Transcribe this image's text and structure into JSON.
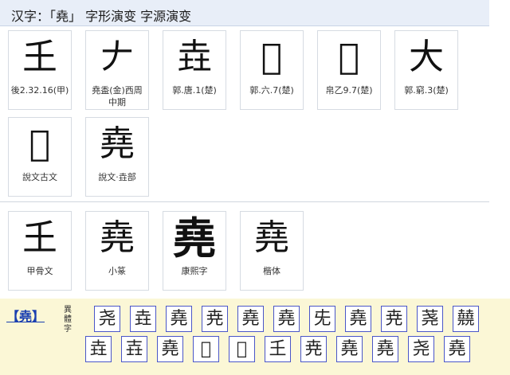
{
  "header": {
    "title": "汉字：「堯」 字形演变 字源演变"
  },
  "evolution": [
    {
      "glyph": "𡈼",
      "caption": "後2.32.16(甲)"
    },
    {
      "glyph": "𠂇",
      "caption": "堯盉(金)西周中期"
    },
    {
      "glyph": "垚",
      "caption": "郭.唐.1(楚)"
    },
    {
      "glyph": "𡉈",
      "caption": "郭.六.7(楚)"
    },
    {
      "glyph": "𡉋",
      "caption": "帛乙9.7(楚)"
    },
    {
      "glyph": "大",
      "caption": "郭.窮.3(楚)"
    },
    {
      "glyph": "𡉈",
      "caption": "說文古文"
    },
    {
      "glyph": "堯",
      "caption": "說文·垚部"
    }
  ],
  "script_styles": [
    {
      "glyph": "𡈼",
      "caption": "甲骨文"
    },
    {
      "glyph": "堯",
      "caption": "小篆"
    },
    {
      "glyph": "堯",
      "caption": "康熙字"
    },
    {
      "glyph": "堯",
      "caption": "楷体"
    }
  ],
  "variants": {
    "link_label": "【堯】",
    "side_label": "異體字",
    "row1": [
      "尧",
      "垚",
      "堯",
      "尭",
      "堯",
      "堯",
      "兂",
      "堯",
      "尭",
      "荛",
      "㚁"
    ],
    "row2": [
      "垚",
      "壵",
      "堯",
      "𡉈",
      "𡉋",
      "𡈼",
      "尭",
      "堯",
      "堯",
      "尧",
      "堯"
    ]
  }
}
